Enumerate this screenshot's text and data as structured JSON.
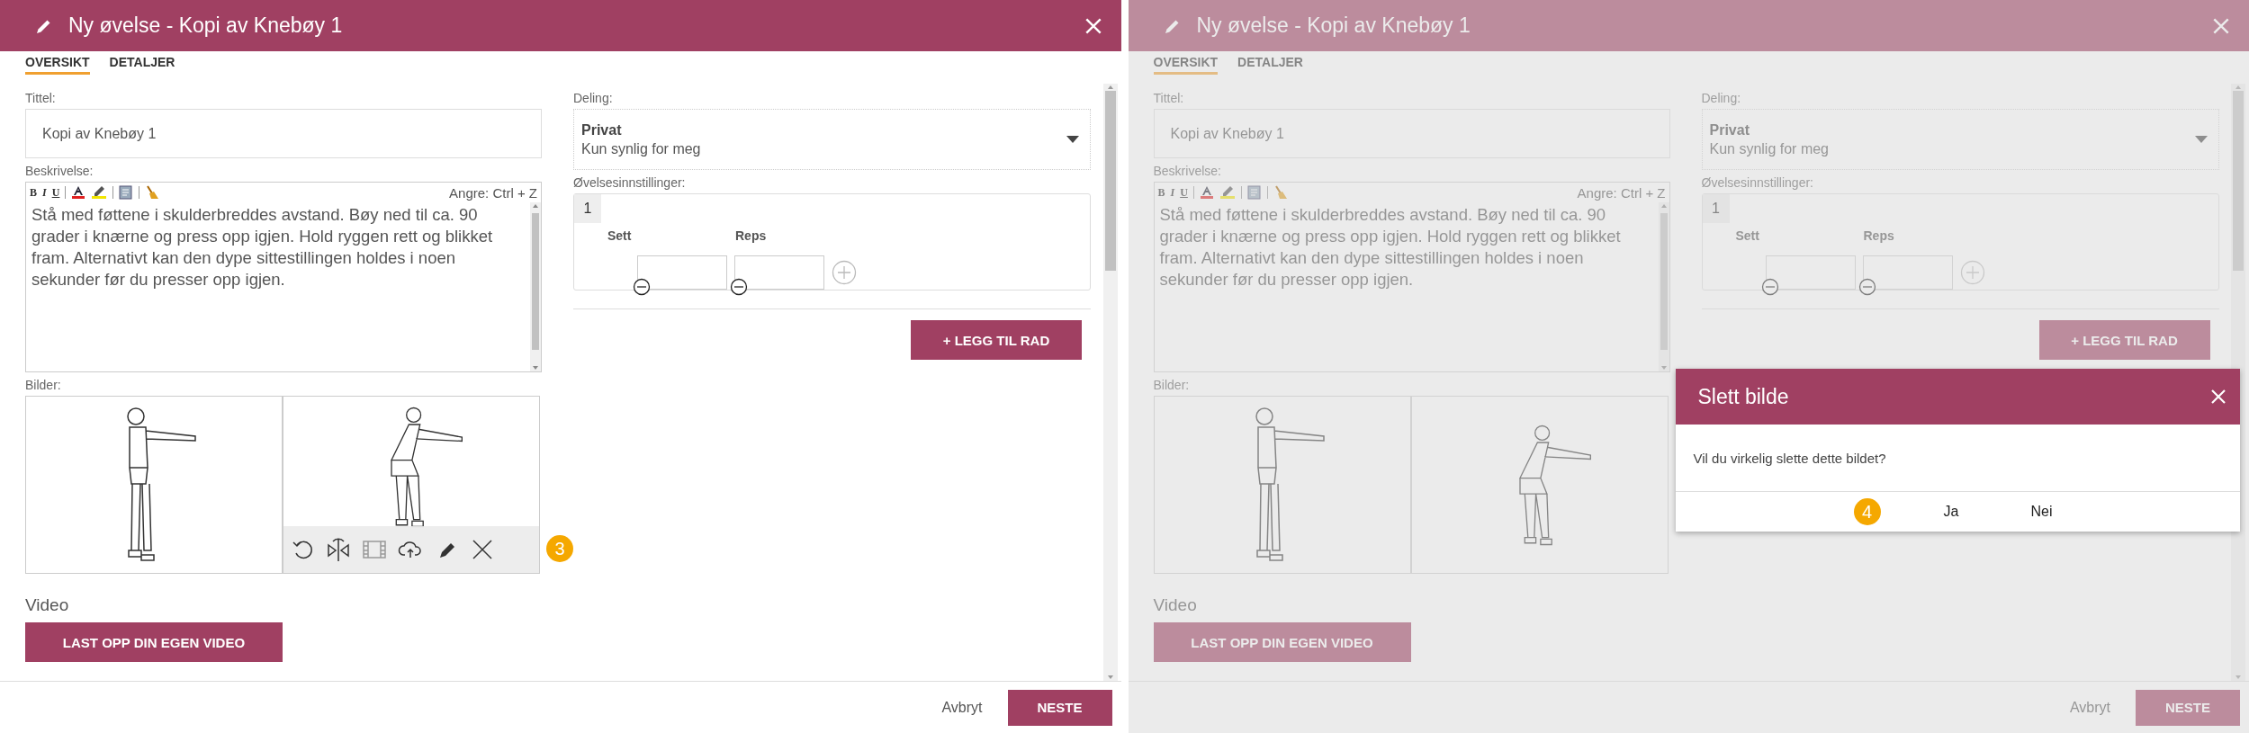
{
  "panels": [
    {
      "dimmed": false,
      "title": "Ny øvelse - Kopi av Knebøy 1",
      "tabs": [
        {
          "label": "OVERSIKT",
          "selected": true
        },
        {
          "label": "DETALJER",
          "selected": false
        }
      ],
      "title_field": {
        "label": "Tittel:",
        "value": "Kopi av Knebøy 1"
      },
      "description": {
        "label": "Beskrivelse:",
        "format_buttons": [
          "B",
          "I",
          "U"
        ],
        "undo_hint": "Angre: Ctrl + Z",
        "text": "Stå med føttene i skulderbreddes avstand. Bøy ned til ca. 90 grader i knærne og press opp igjen. Hold ryggen rett og blikket fram. Alternativt kan den dype sittestillingen holdes i noen sekunder før du presser opp igjen."
      },
      "images": {
        "label": "Bilder:",
        "step_badge": "3",
        "items": [
          {
            "kind": "standing",
            "toolbar": false
          },
          {
            "kind": "squat",
            "toolbar": true
          }
        ]
      },
      "video": {
        "heading": "Video",
        "button": "LAST OPP DIN EGEN VIDEO"
      },
      "sharing": {
        "label": "Deling:",
        "value": "Privat",
        "description": "Kun synlig for meg"
      },
      "settings": {
        "label": "Øvelsesinnstillinger:",
        "rows": [
          {
            "number": "1",
            "columns": [
              "Sett",
              "Reps"
            ]
          }
        ]
      },
      "add_row_button": "+ LEGG TIL RAD",
      "footer": {
        "cancel": "Avbryt",
        "next": "NESTE"
      }
    },
    {
      "dimmed": true,
      "title": "Ny øvelse - Kopi av Knebøy 1",
      "tabs": [
        {
          "label": "OVERSIKT",
          "selected": true
        },
        {
          "label": "DETALJER",
          "selected": false
        }
      ],
      "title_field": {
        "label": "Tittel:",
        "value": "Kopi av Knebøy 1"
      },
      "description": {
        "label": "Beskrivelse:",
        "format_buttons": [
          "B",
          "I",
          "U"
        ],
        "undo_hint": "Angre: Ctrl + Z",
        "text": "Stå med føttene i skulderbreddes avstand. Bøy ned til ca. 90 grader i knærne og press opp igjen. Hold ryggen rett og blikket fram. Alternativt kan den dype sittestillingen holdes i noen sekunder før du presser opp igjen."
      },
      "images": {
        "label": "Bilder:",
        "items": [
          {
            "kind": "standing",
            "toolbar": false
          },
          {
            "kind": "squat",
            "toolbar": false
          }
        ]
      },
      "video": {
        "heading": "Video",
        "button": "LAST OPP DIN EGEN VIDEO"
      },
      "sharing": {
        "label": "Deling:",
        "value": "Privat",
        "description": "Kun synlig for meg"
      },
      "settings": {
        "label": "Øvelsesinnstillinger:",
        "rows": [
          {
            "number": "1",
            "columns": [
              "Sett",
              "Reps"
            ]
          }
        ]
      },
      "add_row_button": "+ LEGG TIL RAD",
      "footer": {
        "cancel": "Avbryt",
        "next": "NESTE"
      },
      "dialog": {
        "title": "Slett bilde",
        "message": "Vil du virkelig slette dette bildet?",
        "step_badge": "4",
        "buttons": [
          "Ja",
          "Nei"
        ]
      }
    }
  ]
}
